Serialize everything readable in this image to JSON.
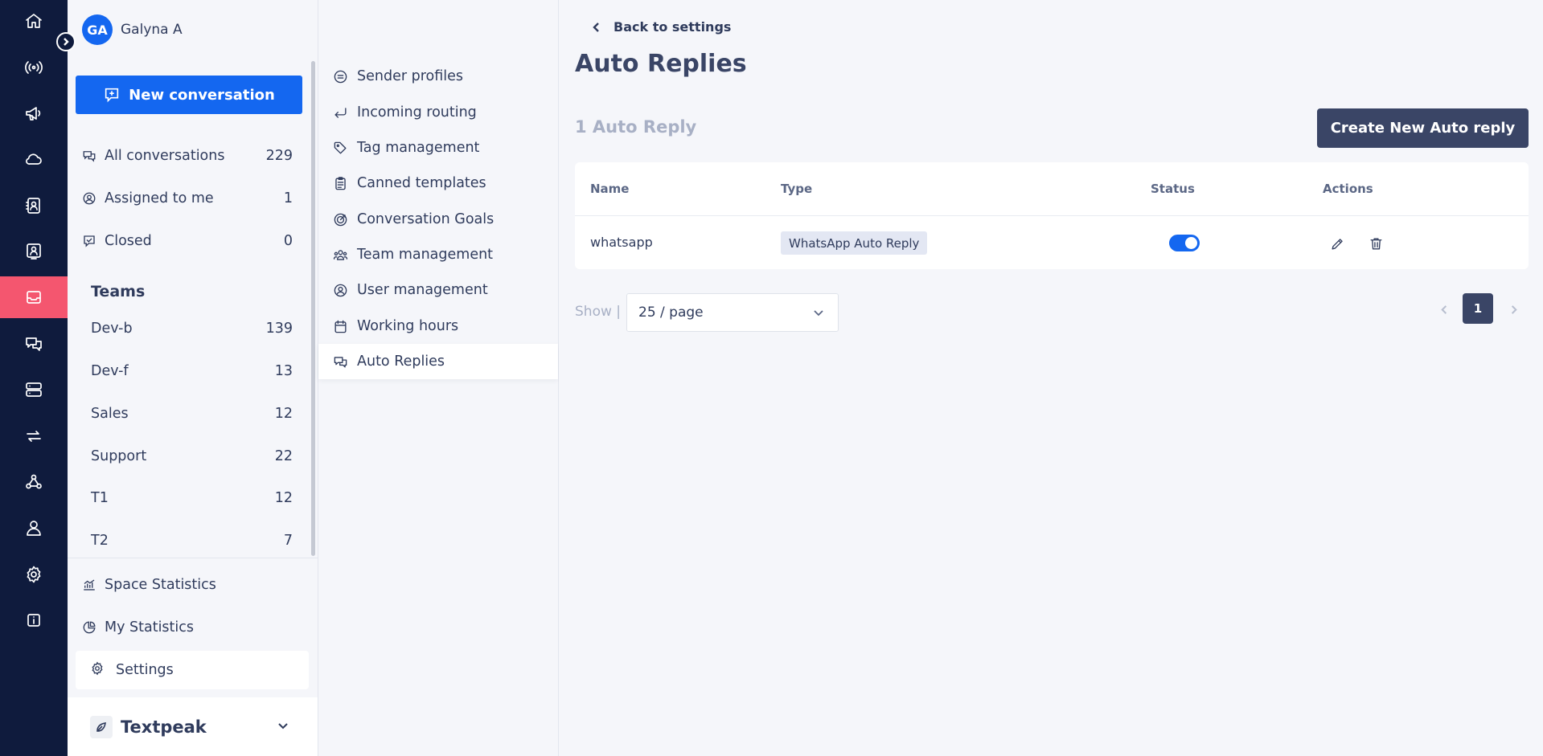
{
  "user": {
    "initials": "GA",
    "name": "Galyna A"
  },
  "conversations": {
    "new_label": "New conversation",
    "items": [
      {
        "label": "All conversations",
        "count": "229"
      },
      {
        "label": "Assigned to me",
        "count": "1"
      },
      {
        "label": "Closed",
        "count": "0"
      }
    ],
    "teams_title": "Teams",
    "teams": [
      {
        "label": "Dev-b",
        "count": "139"
      },
      {
        "label": "Dev-f",
        "count": "13"
      },
      {
        "label": "Sales",
        "count": "12"
      },
      {
        "label": "Support",
        "count": "22"
      },
      {
        "label": "T1",
        "count": "12"
      },
      {
        "label": "T2",
        "count": "7"
      }
    ],
    "footer": [
      {
        "label": "Space Statistics"
      },
      {
        "label": "My Statistics"
      }
    ],
    "settings_label": "Settings",
    "org_name": "Textpeak"
  },
  "settings_menu": [
    {
      "label": "Sender profiles",
      "icon": "sender-profile-icon"
    },
    {
      "label": "Incoming routing",
      "icon": "routing-icon"
    },
    {
      "label": "Tag management",
      "icon": "tag-icon"
    },
    {
      "label": "Canned templates",
      "icon": "clipboard-icon"
    },
    {
      "label": "Conversation Goals",
      "icon": "target-icon"
    },
    {
      "label": "Team management",
      "icon": "team-icon"
    },
    {
      "label": "User management",
      "icon": "user-circle-icon"
    },
    {
      "label": "Working hours",
      "icon": "calendar-icon"
    },
    {
      "label": "Auto Replies",
      "icon": "chat-bubbles-icon",
      "active": true
    }
  ],
  "main": {
    "back_label": "Back to settings",
    "title": "Auto Replies",
    "count_label": "1 Auto Reply",
    "create_label": "Create New Auto reply",
    "table": {
      "headers": {
        "name": "Name",
        "type": "Type",
        "status": "Status",
        "actions": "Actions"
      },
      "rows": [
        {
          "name": "whatsapp",
          "type": "WhatsApp Auto Reply",
          "status_enabled": true
        }
      ]
    },
    "pagination": {
      "show_label": "Show |",
      "page_size": "25 / page",
      "current_page": "1"
    }
  },
  "colors": {
    "rail": "#0f1b3d",
    "rail_active": "#f4566f",
    "primary": "#1467f0",
    "dark_button": "#3a4566"
  }
}
